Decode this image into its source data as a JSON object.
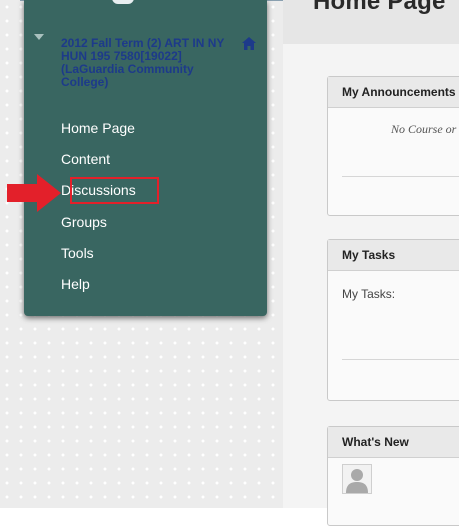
{
  "header": {
    "page_title": "Home Page"
  },
  "course_menu": {
    "course_title": "2012 Fall Term (2) ART IN NY HUN 195 7580[19022] (LaGuardia Community College)",
    "items": [
      {
        "label": "Home Page"
      },
      {
        "label": "Content"
      },
      {
        "label": "Discussions",
        "highlighted": true
      },
      {
        "label": "Groups"
      },
      {
        "label": "Tools"
      },
      {
        "label": "Help"
      }
    ]
  },
  "modules": {
    "announcements": {
      "title": "My Announcements",
      "text": "No Course or O"
    },
    "tasks": {
      "title": "My Tasks",
      "text": "My Tasks:"
    },
    "whats_new": {
      "title": "What's New"
    }
  },
  "colors": {
    "menu_bg": "#396661",
    "course_title": "#1d3a8a",
    "highlight": "#e3202a"
  },
  "icons": [
    "home-icon",
    "collapse-arrow-icon",
    "pointer-arrow-icon",
    "avatar-icon"
  ]
}
